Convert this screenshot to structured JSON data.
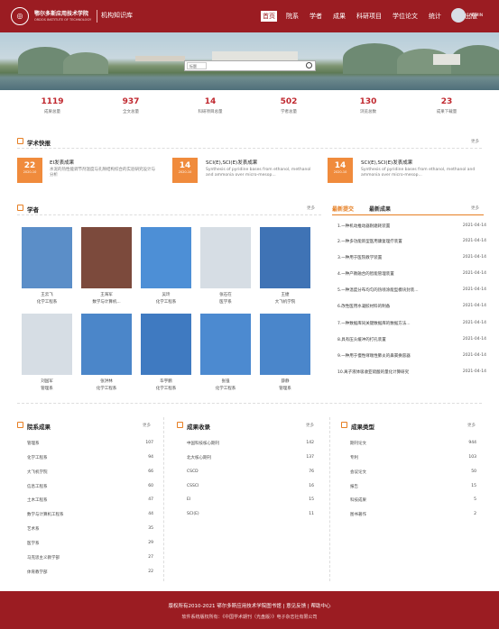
{
  "header": {
    "school_line1": "鄂尔多斯应用技术学院",
    "school_line2": "ORDOS INSTITUTE OF TECHNOLOGY",
    "repo_title": "机构知识库",
    "nav": [
      "首页",
      "院系",
      "学者",
      "成果",
      "科研项目",
      "学位论文",
      "统计",
      "学术出版"
    ],
    "user": "ADMIN"
  },
  "search": {
    "select": "标题",
    "placeholder": ""
  },
  "stats": [
    {
      "value": "1119",
      "label": "成果总量"
    },
    {
      "value": "937",
      "label": "全文总量"
    },
    {
      "value": "14",
      "label": "科研项目总量"
    },
    {
      "value": "502",
      "label": "学者总量"
    },
    {
      "value": "130",
      "label": "浏览总数"
    },
    {
      "value": "23",
      "label": "成果下载量"
    }
  ],
  "news": {
    "title": "学术快报",
    "more": "更多",
    "items": [
      {
        "day": "22",
        "month": "2020-10",
        "title": "EI发表成果",
        "desc": "水泥的热性能调节剂温度与孔隙结构综合的实验研究设计与分析"
      },
      {
        "day": "14",
        "month": "2020-10",
        "title": "SCI(E),SCI(E)发表成果",
        "desc": "Synthesis of pyridine bases from ethanol, methanol and ammonia over micro-mesop..."
      },
      {
        "day": "14",
        "month": "2020-10",
        "title": "SCI(E),SCI(E)发表成果",
        "desc": "Synthesis of pyridine bases from ethanol, methanol and ammonia over micro-mesop..."
      }
    ]
  },
  "scholars": {
    "title": "学者",
    "more": "更多",
    "people": [
      {
        "name": "王云飞",
        "dept": "化学工程系"
      },
      {
        "name": "王海军",
        "dept": "数学与计算机..."
      },
      {
        "name": "吴玲",
        "dept": "化学工程系"
      },
      {
        "name": "张石在",
        "dept": "医学系"
      },
      {
        "name": "王捷",
        "dept": "大飞机学院"
      },
      {
        "name": "刘国军",
        "dept": "管理系"
      },
      {
        "name": "张洪林",
        "dept": "化学工程系"
      },
      {
        "name": "毕宇鹏",
        "dept": "化学工程系"
      },
      {
        "name": "张强",
        "dept": "化学工程系"
      },
      {
        "name": "薛静",
        "dept": "管理系"
      }
    ]
  },
  "recent": {
    "tab_active": "最新提交",
    "tab_other": "最新成果",
    "more": "更多",
    "items": [
      {
        "title": "1.一种机动推动器耐磨耗装置",
        "date": "2021-04-14"
      },
      {
        "title": "2.一种多功能新型医用康复理疗装置",
        "date": "2021-04-14"
      },
      {
        "title": "3.一种用于医院教学装置",
        "date": "2021-04-14"
      },
      {
        "title": "4.一种产教融合的智能管理装置",
        "date": "2021-04-14"
      },
      {
        "title": "5.一种温度分布均匀的热喷涂能型模块封装...",
        "date": "2021-04-14"
      },
      {
        "title": "6.改性医用水凝胶材料的制备",
        "date": "2021-04-14"
      },
      {
        "title": "7.一种数据库同关键数据库的数据方法...",
        "date": "2021-04-14"
      },
      {
        "title": "8.具有压头缓冲的打孔装置",
        "date": "2021-04-14"
      },
      {
        "title": "9.一种用于慢性哮喘性肺炎的鼻窦换容器",
        "date": "2021-04-14"
      },
      {
        "title": "10.离子液体吸收亚硫酸的量化计算研究",
        "date": "2021-04-14"
      }
    ]
  },
  "bottom": {
    "col1": {
      "title": "院系成果",
      "more": "更多",
      "rows": [
        {
          "name": "管理系",
          "count": "107"
        },
        {
          "name": "化学工程系",
          "count": "94"
        },
        {
          "name": "大飞机学院",
          "count": "66"
        },
        {
          "name": "信息工程系",
          "count": "60"
        },
        {
          "name": "土木工程系",
          "count": "47"
        },
        {
          "name": "数学与计算机工程系",
          "count": "44"
        },
        {
          "name": "艺术系",
          "count": "35"
        },
        {
          "name": "医学系",
          "count": "29"
        },
        {
          "name": "马克思主义教学部",
          "count": "27"
        },
        {
          "name": "体育教学部",
          "count": "22"
        }
      ]
    },
    "col2": {
      "title": "成果收录",
      "more": "更多",
      "rows": [
        {
          "name": "中国科技核心期刊",
          "count": "142"
        },
        {
          "name": "北大核心期刊",
          "count": "137"
        },
        {
          "name": "CSCD",
          "count": "76"
        },
        {
          "name": "CSSCI",
          "count": "16"
        },
        {
          "name": "EI",
          "count": "15"
        },
        {
          "name": "SCI(E)",
          "count": "11"
        }
      ]
    },
    "col3": {
      "title": "成果类型",
      "more": "更多",
      "rows": [
        {
          "name": "期刊论文",
          "count": "944"
        },
        {
          "name": "专利",
          "count": "103"
        },
        {
          "name": "会议论文",
          "count": "50"
        },
        {
          "name": "报告",
          "count": "15"
        },
        {
          "name": "科技成果",
          "count": "5"
        },
        {
          "name": "图书著作",
          "count": "2"
        }
      ]
    }
  },
  "footer": {
    "line1": "版权所有2010-2021   鄂尔多斯应用技术学院图书馆  |  意见反馈  |  帮助中心",
    "line2": "软件系统版权所有：《中国学术期刊（光盘版）》电子杂志社有限公司"
  }
}
